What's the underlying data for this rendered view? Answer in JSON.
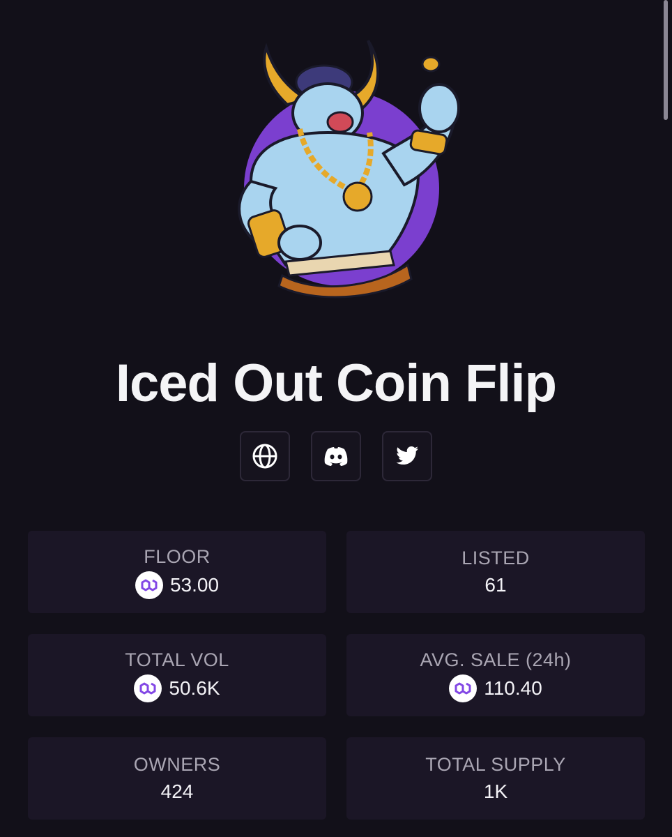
{
  "collection": {
    "title": "Iced Out Coin Flip"
  },
  "avatar": {
    "icon": "bull-character-coin-flip-logo",
    "colors": {
      "circle": "#7b3fcf",
      "skin": "#a9d4ef",
      "gold": "#e6a92a",
      "hair": "#3d3a7a"
    }
  },
  "socials": [
    {
      "icon": "globe-icon"
    },
    {
      "icon": "discord-icon"
    },
    {
      "icon": "twitter-icon"
    }
  ],
  "stats": {
    "floor": {
      "label": "FLOOR",
      "value": "53.00",
      "currency_icon": "polygon-icon"
    },
    "listed": {
      "label": "LISTED",
      "value": "61"
    },
    "total_vol": {
      "label": "TOTAL VOL",
      "value": "50.6K",
      "currency_icon": "polygon-icon"
    },
    "avg_sale": {
      "label": "AVG. SALE (24h)",
      "value": "110.40",
      "currency_icon": "polygon-icon"
    },
    "owners": {
      "label": "OWNERS",
      "value": "424"
    },
    "total_supply": {
      "label": "TOTAL SUPPLY",
      "value": "1K"
    }
  },
  "theme": {
    "background": "#121019",
    "card": "#1b1626",
    "accent_polygon": "#8247e5"
  }
}
